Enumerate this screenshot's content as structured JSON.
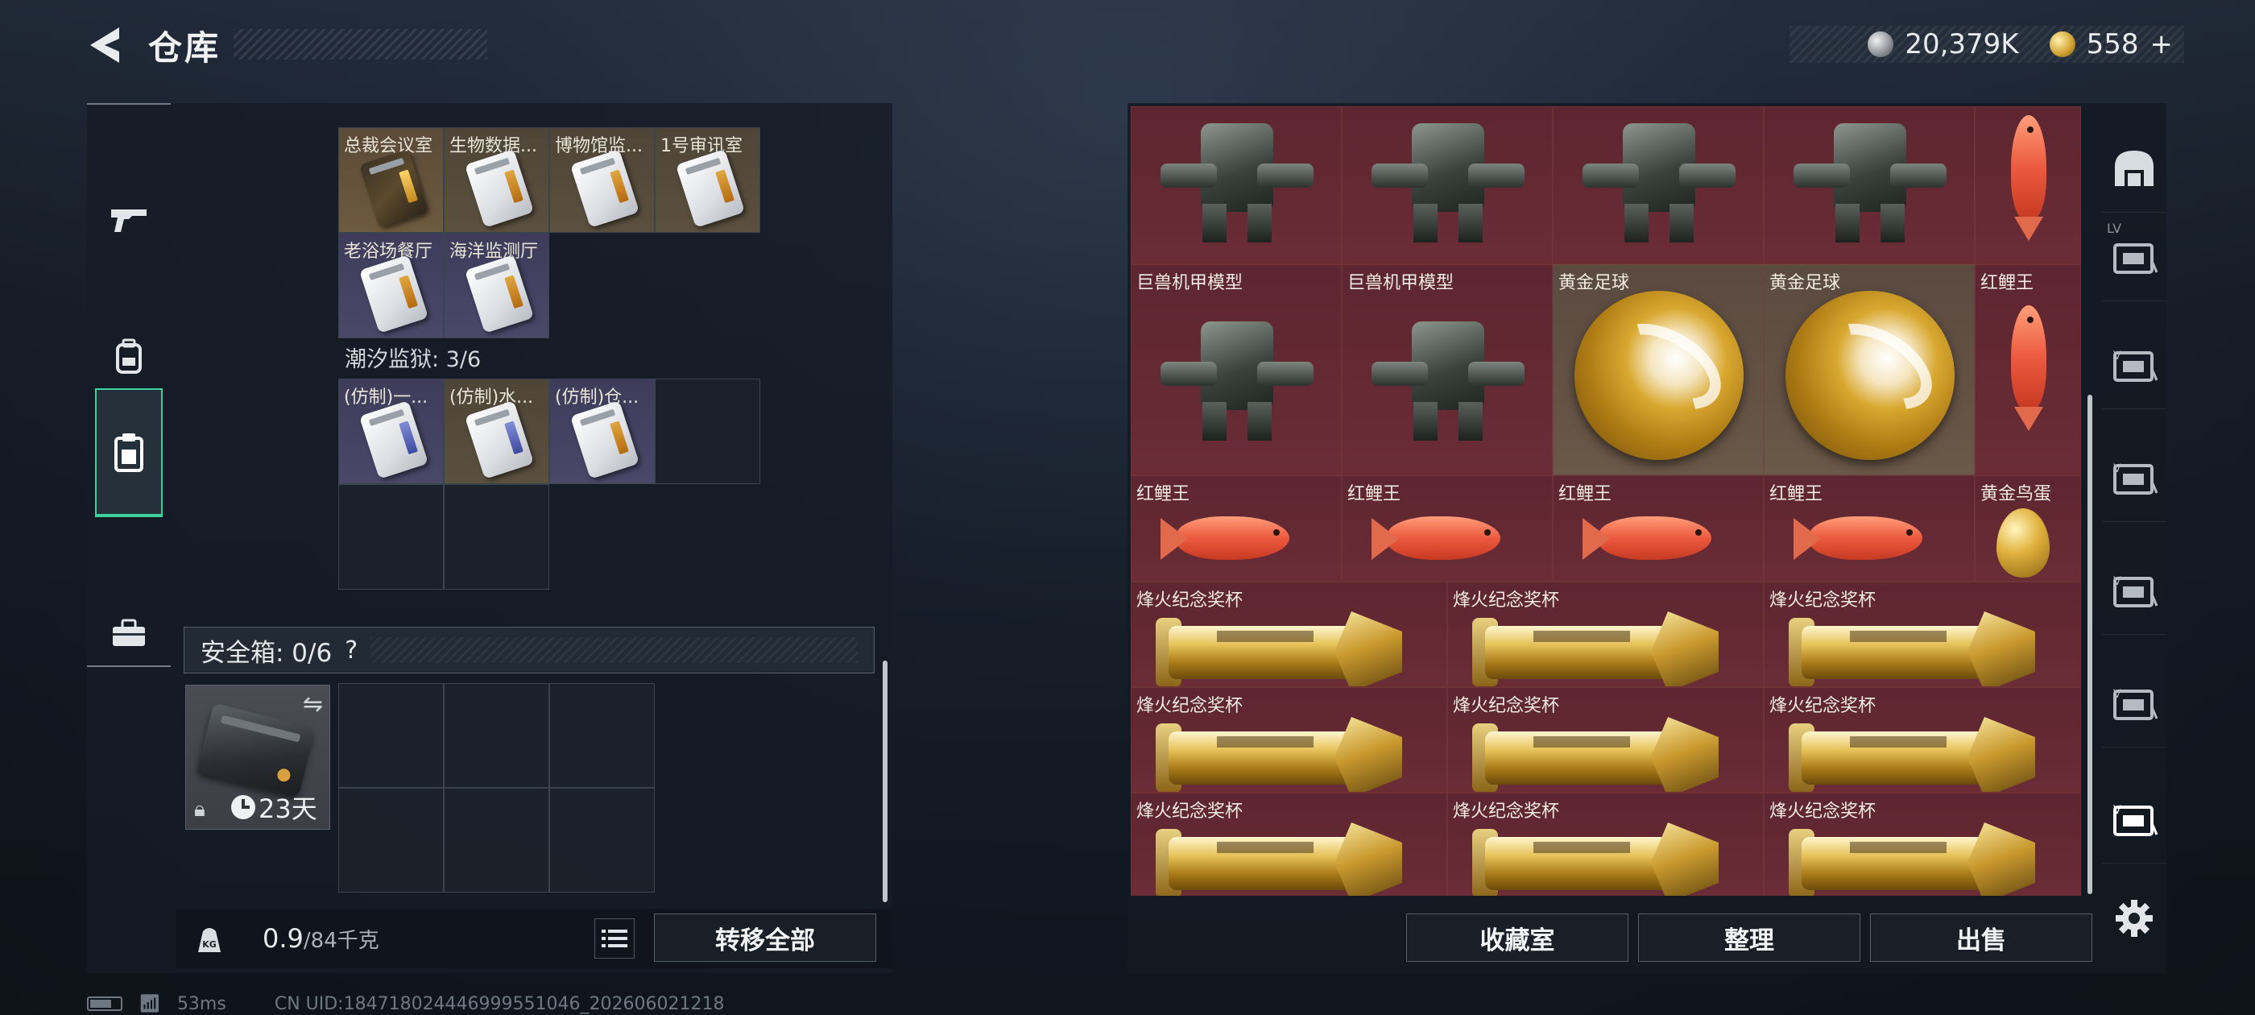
{
  "header": {
    "title": "仓库",
    "currency_silver": "20,379K",
    "currency_gold": "558",
    "currency_plus": "+"
  },
  "left_tabs": [
    {
      "name": "weapons",
      "icon": "gun-icon"
    },
    {
      "name": "equipment",
      "icon": "backpack-icon"
    },
    {
      "name": "storage",
      "icon": "clipboard-icon",
      "active": true
    },
    {
      "name": "toolbox",
      "icon": "toolbox-icon"
    }
  ],
  "left_list": {
    "group1_cards": [
      "总裁会议室",
      "生物数据...",
      "博物馆监...",
      "1号审讯室",
      "老浴场餐厅",
      "海洋监测厅"
    ],
    "group2_label": "潮汐监狱: 3/6",
    "group2_cards": [
      "(仿制)一...",
      "(仿制)水...",
      "(仿制)仓..."
    ]
  },
  "safebox": {
    "label": "安全箱: 0/6",
    "help": "?",
    "timer": "23天"
  },
  "weight": {
    "current": "0.9",
    "max": "/84千克"
  },
  "buttons": {
    "transfer_all": "转移全部",
    "collection_room": "收藏室",
    "organize": "整理",
    "sell": "出售"
  },
  "status": {
    "ping": "53ms",
    "uid": "CN UID:1847180244469995510​46_202606021218"
  },
  "right_items": {
    "mech_label": "巨兽机甲模型",
    "ball_label": "黄金足球",
    "fish_label": "红鲤王",
    "egg_label": "黄金鸟蛋",
    "cup_label": "烽火纪念奖杯"
  },
  "right_tabs": [
    {
      "icon": "helmet-icon"
    },
    {
      "icon": "case-icon",
      "level": "LV"
    },
    {
      "icon": "case-icon"
    },
    {
      "icon": "case-icon"
    },
    {
      "icon": "case-icon"
    },
    {
      "icon": "case-icon"
    },
    {
      "icon": "case-icon",
      "active": true
    }
  ]
}
